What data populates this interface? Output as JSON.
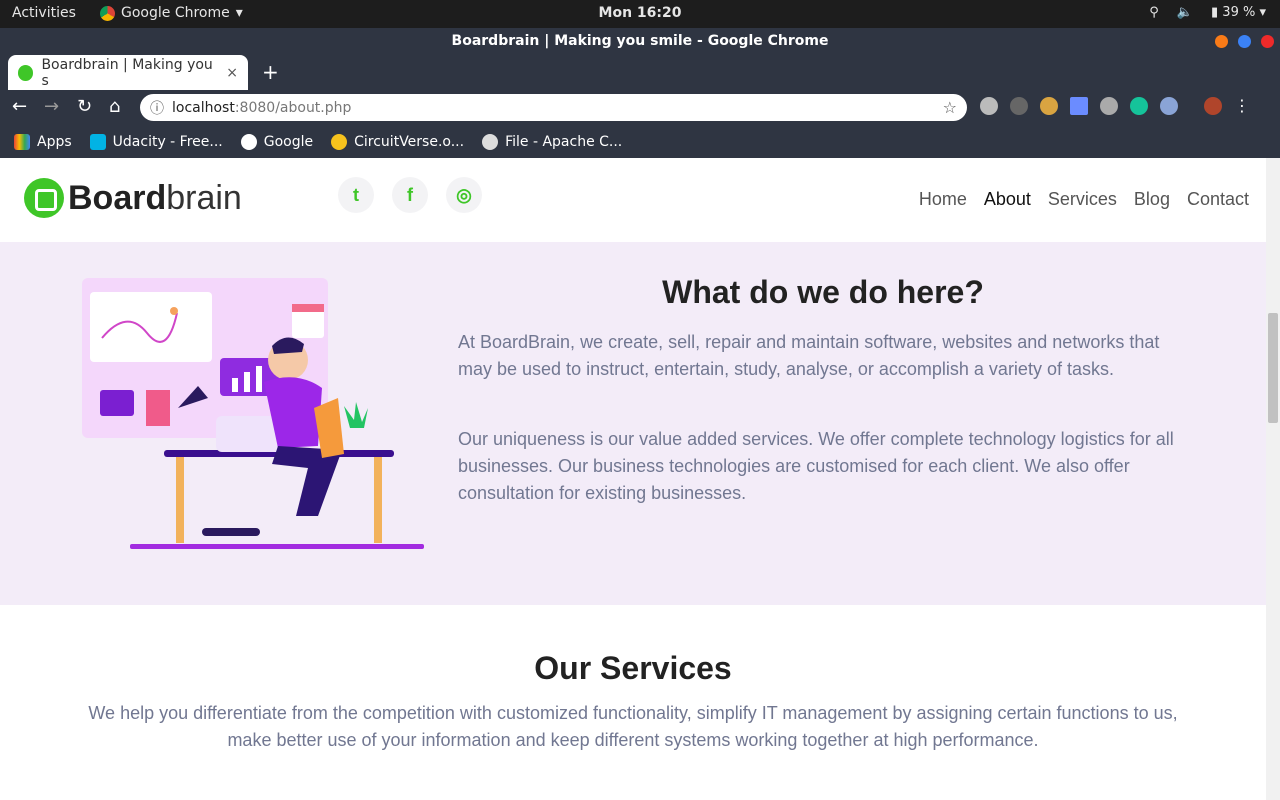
{
  "os": {
    "activities": "Activities",
    "app_name": "Google Chrome",
    "clock": "Mon 16:20",
    "battery": "39 %"
  },
  "window": {
    "title": "Boardbrain | Making you smile - Google Chrome"
  },
  "tab": {
    "title": "Boardbrain | Making you s",
    "close": "×",
    "new_tab": "+"
  },
  "address": {
    "host": "localhost",
    "path": ":8080/about.php"
  },
  "bookmarks": [
    {
      "label": "Apps"
    },
    {
      "label": "Udacity - Free..."
    },
    {
      "label": "Google"
    },
    {
      "label": "CircuitVerse.o..."
    },
    {
      "label": "File - Apache C..."
    }
  ],
  "site": {
    "logo_bold": "Board",
    "logo_light": "brain",
    "nav": [
      "Home",
      "About",
      "Services",
      "Blog",
      "Contact"
    ],
    "active_nav": "About",
    "social": {
      "twitter": "t",
      "facebook": "f",
      "instagram": "◎"
    }
  },
  "about": {
    "heading": "What do we do here?",
    "para1": "At BoardBrain, we create, sell, repair and maintain software, websites and networks that may be used to instruct, entertain, study, analyse, or accomplish a variety of tasks.",
    "para2": "Our uniqueness is our value added services. We offer complete technology logistics for all businesses. Our business technologies are customised for each client. We also offer consultation for existing businesses."
  },
  "services": {
    "heading": "Our Services",
    "para": "We help you differentiate from the competition with customized functionality, simplify IT management by assigning certain functions to us, make better use of your information and keep different systems working together at high performance."
  },
  "colors": {
    "brand_green": "#3fc628",
    "purple": "#8a2be2",
    "about_bg": "#f3ecf8"
  }
}
